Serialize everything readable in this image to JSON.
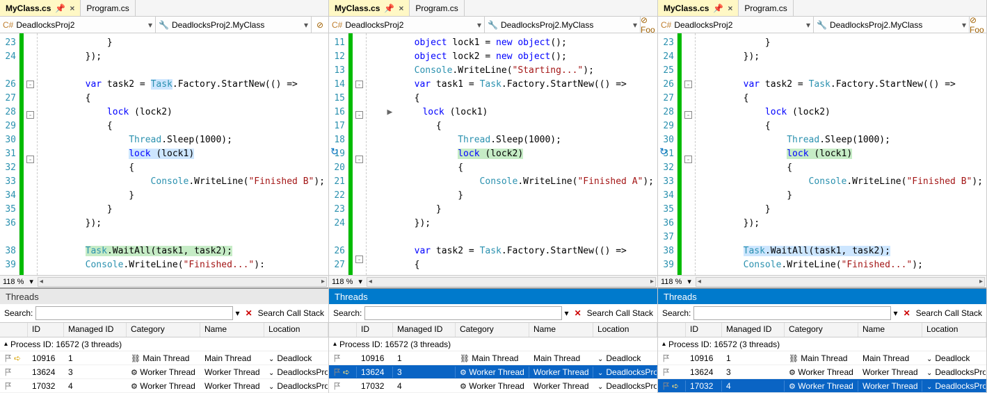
{
  "tabs": {
    "active": "MyClass.cs",
    "inactive": "Program.cs"
  },
  "dropdowns": {
    "left": "DeadlocksProj2",
    "right": "DeadlocksProj2.MyClass",
    "extra": "Foo"
  },
  "zoom": "118 %",
  "threads": {
    "title": "Threads",
    "searchLabel": "Search:",
    "clearLabel": "Search Call Stack",
    "cols": [
      "ID",
      "Managed ID",
      "Category",
      "Name",
      "Location"
    ],
    "proc": "Process ID: 16572  (3 threads)",
    "rows": [
      {
        "id": "10916",
        "mid": "1",
        "cat": "Main Thread",
        "name": "Main Thread",
        "loc": "Deadlock",
        "main": true
      },
      {
        "id": "13624",
        "mid": "3",
        "cat": "Worker Thread",
        "name": "Worker Thread",
        "loc": "DeadlocksPro",
        "main": false
      },
      {
        "id": "17032",
        "mid": "4",
        "cat": "Worker Thread",
        "name": "Worker Thread",
        "loc": "DeadlocksPro",
        "main": false
      }
    ]
  },
  "p1": {
    "lns": [
      "23",
      "24",
      "",
      "26",
      "27",
      "28",
      "29",
      "30",
      "31",
      "32",
      "33",
      "34",
      "35",
      "36",
      "",
      "38",
      "39"
    ],
    "code": [
      "            }",
      "        });",
      "",
      "        <span class='kw'>var</span> task2 = <span class='hl-sel'><span class='typ'>Task</span></span>.Factory.StartNew(() =>",
      "        {",
      "            <span class='kw'>lock</span> (lock2)",
      "            {",
      "                <span class='typ'>Thread</span>.Sleep(1000);",
      "                <span class='hl-sel'><span class='kw'>lock</span> (lock1)</span>",
      "                {",
      "                    <span class='typ'>Console</span>.WriteLine(<span class='str'>\"Finished B\"</span>);",
      "                }",
      "            }",
      "        });",
      "",
      "        <span class='hl-green'><span class='typ'>Task</span>.WaitAll(task1, task2);</span>",
      "        <span class='typ'>Console</span>.WriteLine(<span class='str'>\"Finished...\"</span>):"
    ]
  },
  "p2": {
    "lns": [
      "11",
      "12",
      "13",
      "14",
      "15",
      "16",
      "17",
      "18",
      "19",
      "20",
      "21",
      "22",
      "23",
      "24",
      "",
      "26",
      "27"
    ],
    "code": [
      "        <span class='kw'>object</span> lock1 = <span class='kw'>new</span> <span class='kw'>object</span>();",
      "        <span class='kw'>object</span> lock2 = <span class='kw'>new</span> <span class='kw'>object</span>();",
      "        <span class='typ'>Console</span>.WriteLine(<span class='str'>\"Starting...\"</span>);",
      "        <span class='kw'>var</span> task1 = <span class='typ'>Task</span>.Factory.StartNew(() =>",
      "        {",
      "   <span class='dbg'>▶</span>     <span class='kw'>lock</span> (lock1)",
      "            {",
      "                <span class='typ'>Thread</span>.Sleep(1000);",
      "                <span class='hl-green'><span class='kw'>lock</span> (lock2)</span>",
      "                {",
      "                    <span class='typ'>Console</span>.WriteLine(<span class='str'>\"Finished A\"</span>);",
      "                }",
      "            }",
      "        });",
      "",
      "        <span class='kw'>var</span> task2 = <span class='typ'>Task</span>.Factory.StartNew(() =>",
      "        {"
    ]
  },
  "p3": {
    "lns": [
      "23",
      "24",
      "25",
      "26",
      "27",
      "28",
      "29",
      "30",
      "31",
      "32",
      "33",
      "34",
      "35",
      "36",
      "37",
      "38",
      "39"
    ],
    "code": [
      "            }",
      "        });",
      "",
      "        <span class='kw'>var</span> task2 = <span class='typ'>Task</span>.Factory.StartNew(() =>",
      "        {",
      "            <span class='kw'>lock</span> (lock2)",
      "            {",
      "                <span class='typ'>Thread</span>.Sleep(1000);",
      "                <span class='hl-green'><span class='kw'>lock</span> (lock1)</span>",
      "                {",
      "                    <span class='typ'>Console</span>.WriteLine(<span class='str'>\"Finished B\"</span>);",
      "                }",
      "            }",
      "        });",
      "",
      "        <span class='hl-sel'><span class='typ'>Task</span>.WaitAll(task1, task2);</span>",
      "        <span class='typ'>Console</span>.WriteLine(<span class='str'>\"Finished...\"</span>);"
    ]
  },
  "activeRows": [
    0,
    1,
    2
  ],
  "panelActive": [
    0,
    1,
    1
  ],
  "selRow": [
    null,
    1,
    2
  ],
  "curRow": [
    0,
    1,
    2
  ]
}
